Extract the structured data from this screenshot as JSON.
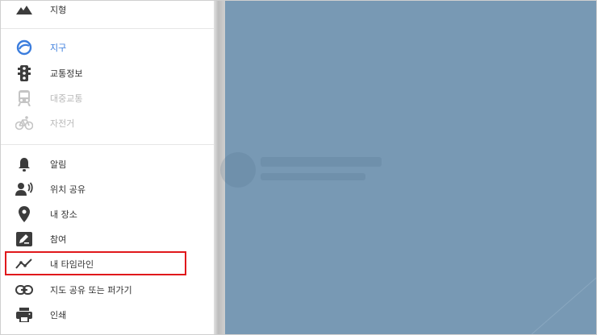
{
  "sidebar": {
    "items": [
      {
        "id": "terrain",
        "label": "지형",
        "icon": "mountain-icon"
      },
      {
        "id": "earth",
        "label": "지구",
        "icon": "globe-icon",
        "state": "active"
      },
      {
        "id": "traffic",
        "label": "교통정보",
        "icon": "traffic-light-icon"
      },
      {
        "id": "transit",
        "label": "대중교통",
        "icon": "train-icon",
        "state": "disabled"
      },
      {
        "id": "bicycle",
        "label": "자전거",
        "icon": "bicycle-icon",
        "state": "disabled"
      },
      {
        "id": "notifications",
        "label": "알림",
        "icon": "bell-icon"
      },
      {
        "id": "location-sharing",
        "label": "위치 공유",
        "icon": "person-share-icon"
      },
      {
        "id": "your-places",
        "label": "내 장소",
        "icon": "map-pin-icon"
      },
      {
        "id": "contribute",
        "label": "참여",
        "icon": "edit-icon"
      },
      {
        "id": "timeline",
        "label": "내 타임라인",
        "icon": "timeline-icon",
        "state": "highlighted"
      },
      {
        "id": "share-embed",
        "label": "지도 공유 또는 퍼가기",
        "icon": "link-icon"
      },
      {
        "id": "print",
        "label": "인쇄",
        "icon": "print-icon"
      }
    ]
  },
  "colors": {
    "map_background": "#7899b4",
    "active_accent": "#3b7ddd",
    "highlight_border": "#e0181b",
    "icon_default": "#3c3c3c",
    "icon_disabled": "#c4c4c4"
  }
}
